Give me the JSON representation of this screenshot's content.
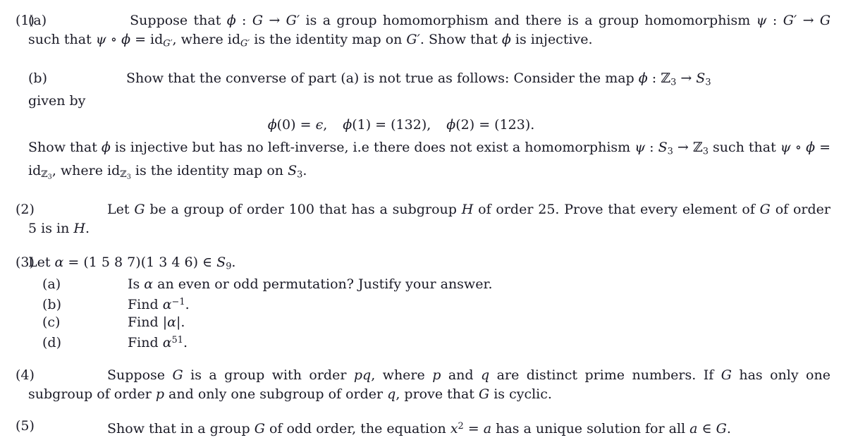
{
  "document": {
    "type": "math-problem-set",
    "topic": "Group theory homework problems",
    "text_color": "#1a1a26",
    "background_color": "#ffffff"
  },
  "problems": [
    {
      "label": "(1)",
      "parts": [
        {
          "label": "(a)",
          "line1_a": "Suppose that ",
          "phi": "ϕ",
          "colon": " : ",
          "G": "G",
          "arrow": " → ",
          "Gprime": "G′",
          "line1_b": " is a group homomorphism and there is a group homomorphism",
          "line2_a": "ψ",
          "line2_b": " : ",
          "line2_c": "G′",
          "line2_d": " → ",
          "line2_e": "G",
          "line2_f": " such that ",
          "line2_g": "ψ",
          "line2_h": " ∘ ",
          "line2_i": "ϕ",
          "line2_j": " = ",
          "line2_k": "id",
          "line2_sub": "G′",
          "line2_l": ", where ",
          "line2_m": "id",
          "line2_sub2": "G′",
          "line2_n": " is the identity map on ",
          "line2_o": "G′",
          "line2_p": ". Show that ",
          "line2_q": "ϕ",
          "line2_r": " is injective."
        },
        {
          "label": "(b)",
          "line1_a": "Show that the converse of part (a) is not true as follows: Consider the map ",
          "line1_phi": "ϕ",
          "line1_colon": " : ",
          "line1_Z3": "ℤ",
          "line1_Z3sub": "3",
          "line1_arrow": " → ",
          "line1_S3": "S",
          "line1_S3sub": "3",
          "line2": "given by",
          "equation": {
            "term1_fn": "ϕ",
            "term1_arg": "(0)",
            "term1_eq": " = ",
            "term1_val": "ϵ",
            "term1_comma": ",",
            "term2_fn": "ϕ",
            "term2_arg": "(1)",
            "term2_eq": " = ",
            "term2_val": "(132)",
            "term2_comma": ",",
            "term3_fn": "ϕ",
            "term3_arg": "(2)",
            "term3_eq": " = ",
            "term3_val": "(123)",
            "term3_period": "."
          },
          "line3_a": "Show that ",
          "line3_phi": "ϕ",
          "line3_b": " is injective but has no left-inverse, i.e there does not exist a homomorphism ",
          "line3_psi": "ψ",
          "line3_colon": " : ",
          "line3_S3": "S",
          "line3_S3sub": "3",
          "line3_arrow": " → ",
          "line3_Z3": "ℤ",
          "line3_Z3sub": "3",
          "line3_c": " such",
          "line4_a": "that ",
          "line4_psi": "ψ",
          "line4_circ": " ∘ ",
          "line4_phi": "ϕ",
          "line4_eq": " = ",
          "line4_id": "id",
          "line4_idsub_Z": "ℤ",
          "line4_idsub_3": "3",
          "line4_b": ", where ",
          "line4_id2": "id",
          "line4_id2sub_Z": "ℤ",
          "line4_id2sub_3": "3",
          "line4_c": " is the identity map on ",
          "line4_S3": "S",
          "line4_S3sub": "3",
          "line4_period": "."
        }
      ]
    },
    {
      "label": "(2)",
      "line1_a": "Let ",
      "line1_G": "G",
      "line1_b": " be a group of order 100 that has a subgroup ",
      "line1_H": "H",
      "line1_c": " of order 25. Prove that every element of ",
      "line1_G2": "G",
      "line2_a": "of order 5 is in ",
      "line2_H": "H",
      "line2_b": "."
    },
    {
      "label": "(3)",
      "stem_a": "Let ",
      "stem_alpha": "α",
      "stem_eq": " = ",
      "stem_cycles": "(1 5 8 7)(1 3 4 6)",
      "stem_in": " ∈ ",
      "stem_S": "S",
      "stem_Ssub": "9",
      "stem_period": ".",
      "subitems": [
        {
          "label": "(a)",
          "text_a": "Is ",
          "sym": "α",
          "text_b": " an even or odd permutation? Justify your answer."
        },
        {
          "label": "(b)",
          "text_a": "Find ",
          "sym": "α",
          "sup": "−1",
          "text_b": "."
        },
        {
          "label": "(c)",
          "text_a": "Find |",
          "sym": "α",
          "text_b": "|."
        },
        {
          "label": "(d)",
          "text_a": "Find ",
          "sym": "α",
          "sup": "51",
          "text_b": "."
        }
      ]
    },
    {
      "label": "(4)",
      "line1_a": "Suppose ",
      "line1_G": "G",
      "line1_b": " is a group with order ",
      "line1_pq": "pq",
      "line1_c": ", where ",
      "line1_p": "p",
      "line1_d": " and ",
      "line1_q": "q",
      "line1_e": " are distinct prime numbers. If ",
      "line1_G2": "G",
      "line1_f": " has only one",
      "line2_a": "subgroup of order ",
      "line2_p": "p",
      "line2_b": " and only one subgroup of order ",
      "line2_q": "q",
      "line2_c": ", prove that ",
      "line2_G": "G",
      "line2_d": " is cyclic."
    },
    {
      "label": "(5)",
      "line1_a": "Show that in a group ",
      "line1_G": "G",
      "line1_b": " of odd order, the equation ",
      "line1_x": "x",
      "line1_xsup": "2",
      "line1_eq": " = ",
      "line1_a2": "a",
      "line1_c": " has a unique solution for all ",
      "line1_a3": "a",
      "line1_in": " ∈ ",
      "line1_G2": "G",
      "line1_period": "."
    }
  ]
}
